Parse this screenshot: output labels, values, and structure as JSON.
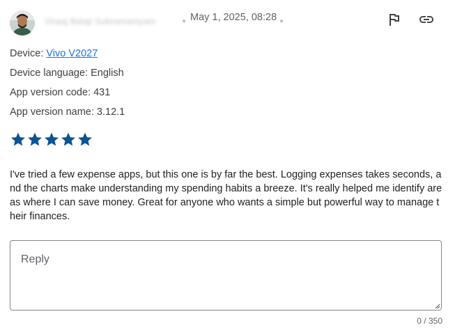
{
  "review": {
    "author_name": "Viraaj Balaji Subramaniyam",
    "date": "May 1, 2025, 08:28",
    "device_label": "Device: ",
    "device_value": "Vivo V2027",
    "language": "Device language: English",
    "version_code": "App version code: 431",
    "version_name": "App version name: 3.12.1",
    "rating": 5,
    "rating_max": 5,
    "star_color": "#0b5394",
    "text": "I've tried a few expense apps, but this one is by far the best. Logging expenses takes seconds, and the charts make understanding my spending habits a breeze. It's really helped me identify areas where I can save money. Great for anyone who wants a simple but powerful way to manage their finances."
  },
  "actions": {
    "flag_icon": "flag-icon",
    "link_icon": "link-icon"
  },
  "reply": {
    "placeholder": "Reply",
    "value": "",
    "counter": "0 / 350"
  }
}
